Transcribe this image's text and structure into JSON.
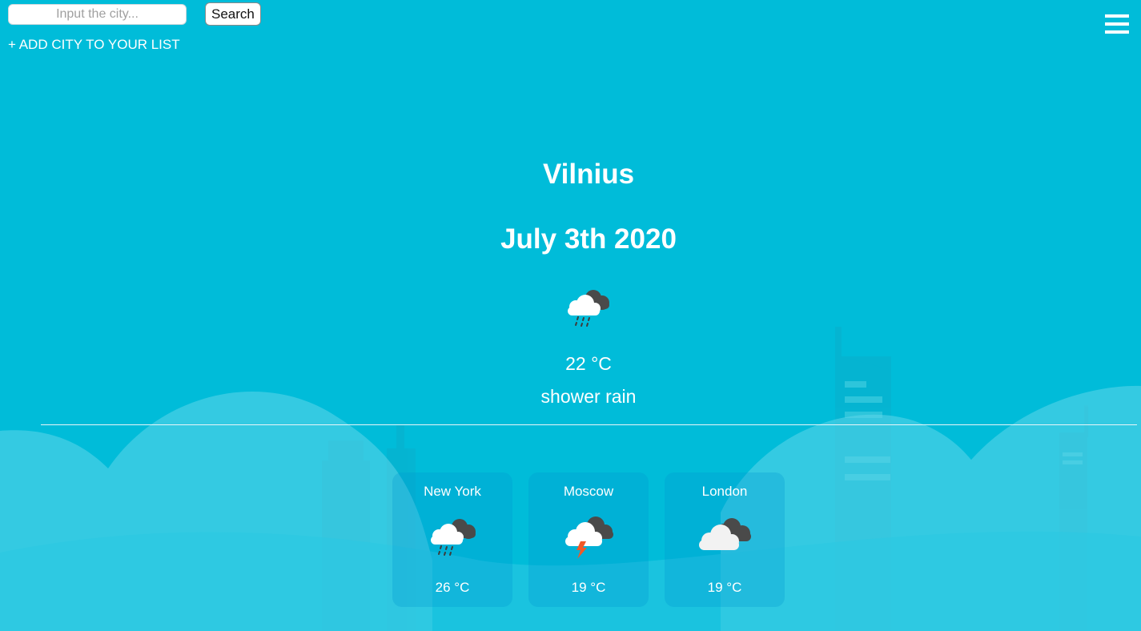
{
  "search": {
    "placeholder": "Input the city...",
    "button_label": "Search"
  },
  "add_city_label": "+ ADD CITY TO YOUR LIST",
  "current": {
    "city": "Vilnius",
    "date": "July 3th 2020",
    "icon": "shower-rain-icon",
    "temperature": "22 °C",
    "description": "shower rain"
  },
  "cities": [
    {
      "name": "New York",
      "icon": "shower-rain-icon",
      "temperature": "26 °C"
    },
    {
      "name": "Moscow",
      "icon": "thunderstorm-icon",
      "temperature": "19 °C"
    },
    {
      "name": "London",
      "icon": "broken-clouds-icon",
      "temperature": "19 °C"
    }
  ],
  "colors": {
    "background": "#00bcd9",
    "text": "#ffffff",
    "lightning": "#f05a28"
  }
}
